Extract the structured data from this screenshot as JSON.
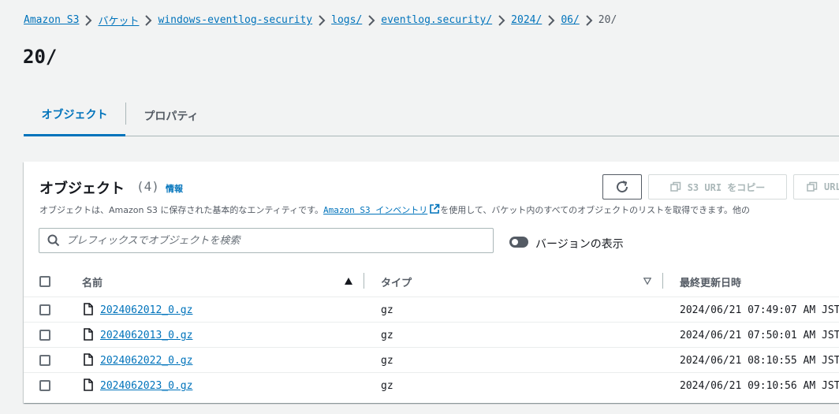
{
  "breadcrumb": [
    {
      "label": "Amazon S3"
    },
    {
      "label": "バケット"
    },
    {
      "label": "windows-eventlog-security"
    },
    {
      "label": "logs/"
    },
    {
      "label": "eventlog.security/"
    },
    {
      "label": "2024/"
    },
    {
      "label": "06/"
    },
    {
      "label": "20/"
    }
  ],
  "page_title": "20/",
  "tabs": [
    {
      "label": "オブジェクト",
      "active": true
    },
    {
      "label": "プロパティ",
      "active": false
    }
  ],
  "panel": {
    "title": "オブジェクト",
    "count": "(4)",
    "info_label": "情報",
    "desc_prefix": "オブジェクトは、Amazon S3 に保存された基本的なエンティティです。",
    "desc_link": "Amazon S3 インベントリ",
    "desc_suffix": "を使用して、バケット内のすべてのオブジェクトのリストを取得できます。他の",
    "copy_uri_label": "S3 URI をコピー",
    "copy_url_label": "URL",
    "search_placeholder": "プレフィックスでオブジェクトを検索",
    "versions_toggle_label": "バージョンの表示"
  },
  "table": {
    "columns": [
      "名前",
      "タイプ",
      "最終更新日時"
    ],
    "rows": [
      {
        "name": "2024062012_0.gz",
        "type": "gz",
        "modified": "2024/06/21 07:49:07 AM JST"
      },
      {
        "name": "2024062013_0.gz",
        "type": "gz",
        "modified": "2024/06/21 07:50:01 AM JST"
      },
      {
        "name": "2024062022_0.gz",
        "type": "gz",
        "modified": "2024/06/21 08:10:55 AM JST"
      },
      {
        "name": "2024062023_0.gz",
        "type": "gz",
        "modified": "2024/06/21 09:10:56 AM JST"
      }
    ]
  },
  "colors": {
    "link": "#0073bb",
    "background": "#f2f3f3",
    "text": "#16191f"
  }
}
